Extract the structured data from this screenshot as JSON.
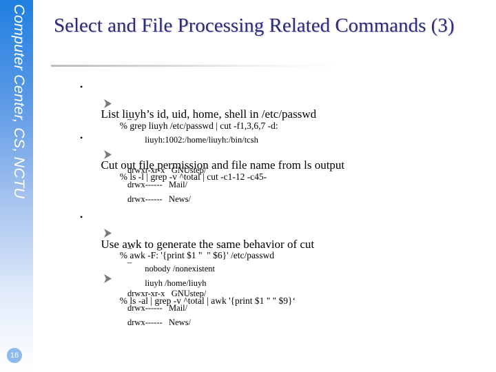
{
  "sidebar": {
    "label": "Computer Center, CS, NCTU",
    "page_number": "16"
  },
  "title": "Select and File Processing Related Commands (3)",
  "content": {
    "b1": {
      "bullet": "•",
      "text": "List liuyh’s id, uid, home, shell in /etc/passwd",
      "cmd": "% grep liuyh /etc/passwd | cut -f1,3,6,7 -d:",
      "out": [
        "liuyh:1002:/home/liuyh:/bin/tcsh"
      ]
    },
    "b2": {
      "bullet": "•",
      "text": "Cut out file permission and file name from ls output",
      "cmd": "% ls -l | grep -v ^total | cut -c1-12 -c45-",
      "out": [
        "drwxr-xr-x   GNUstep/",
        "drwx------   Mail/",
        "drwx------   News/"
      ]
    },
    "b3": {
      "bullet": "•",
      "text": "Use awk to generate the same behavior of cut",
      "cmd1": "% awk -F: '{print $1 \"  \" $6}' /etc/passwd",
      "out1": [
        "nobody /nonexistent",
        "liuyh /home/liuyh"
      ],
      "cmd2": "% ls -al | grep -v ^total | awk '{print $1 \" \" $9}‘",
      "out2": [
        "drwxr-xr-x   GNUstep/",
        "drwx------   Mail/",
        "drwx------   News/"
      ]
    },
    "dash": "–"
  }
}
